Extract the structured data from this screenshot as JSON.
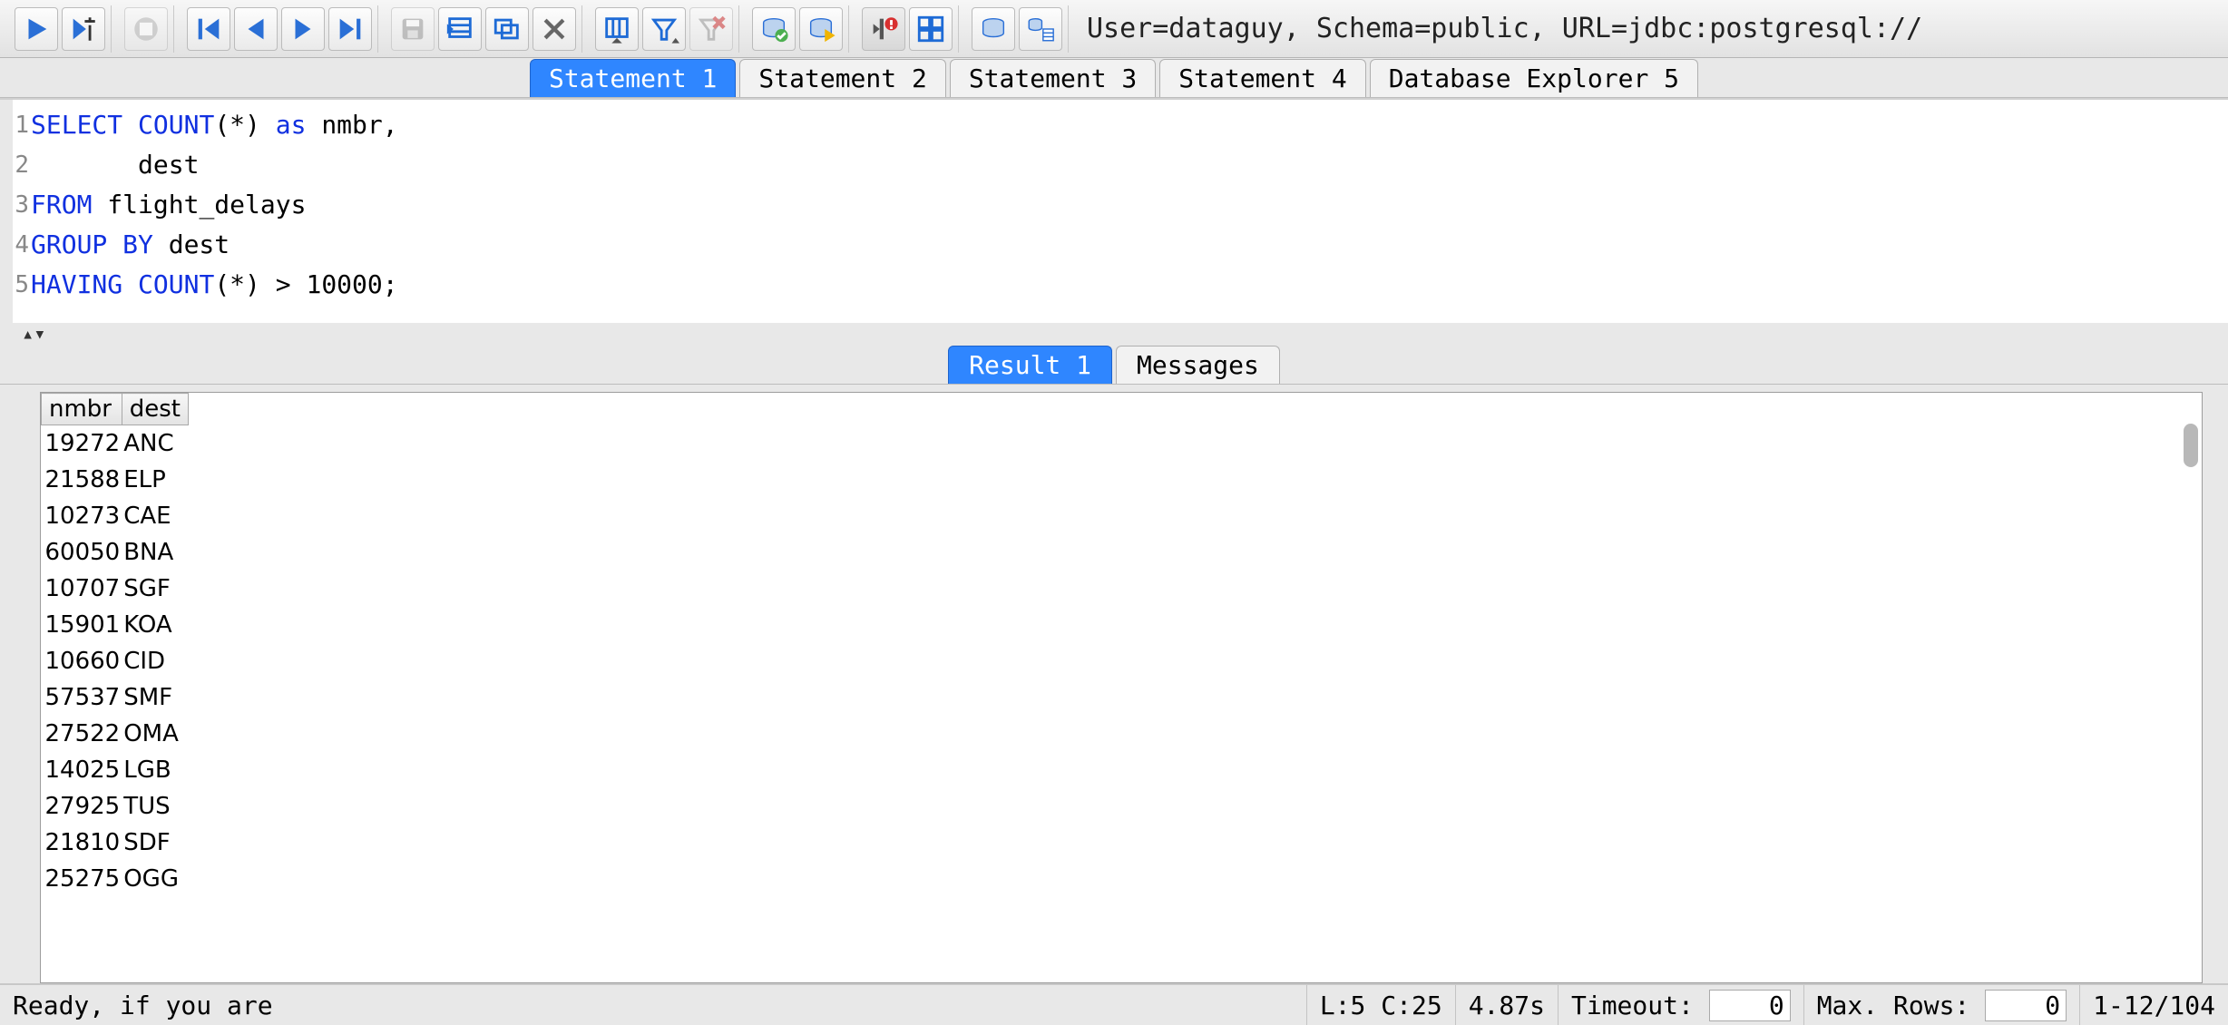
{
  "connection_info": "User=dataguy, Schema=public, URL=jdbc:postgresql://",
  "statement_tabs": [
    {
      "label": "Statement 1",
      "active": true
    },
    {
      "label": "Statement 2",
      "active": false
    },
    {
      "label": "Statement 3",
      "active": false
    },
    {
      "label": "Statement 4",
      "active": false
    },
    {
      "label": "Database Explorer 5",
      "active": false
    }
  ],
  "sql": {
    "lines": [
      {
        "n": "1",
        "tokens": [
          {
            "t": "SELECT",
            "c": "kw"
          },
          {
            "t": " ",
            "c": ""
          },
          {
            "t": "COUNT",
            "c": "fn"
          },
          {
            "t": "(*) ",
            "c": "ident"
          },
          {
            "t": "as",
            "c": "kw"
          },
          {
            "t": " nmbr,",
            "c": "ident"
          }
        ]
      },
      {
        "n": "2",
        "tokens": [
          {
            "t": "       dest",
            "c": "ident"
          }
        ]
      },
      {
        "n": "3",
        "tokens": [
          {
            "t": "FROM",
            "c": "kw"
          },
          {
            "t": " flight_delays",
            "c": "ident"
          }
        ]
      },
      {
        "n": "4",
        "tokens": [
          {
            "t": "GROUP BY",
            "c": "kw"
          },
          {
            "t": " dest",
            "c": "ident"
          }
        ]
      },
      {
        "n": "5",
        "tokens": [
          {
            "t": "HAVING",
            "c": "kw"
          },
          {
            "t": " ",
            "c": ""
          },
          {
            "t": "COUNT",
            "c": "fn"
          },
          {
            "t": "(*) > 10000;",
            "c": "ident"
          }
        ]
      }
    ]
  },
  "result_tabs": [
    {
      "label": "Result 1",
      "active": true
    },
    {
      "label": "Messages",
      "active": false
    }
  ],
  "result": {
    "columns": [
      "nmbr",
      "dest"
    ],
    "rows": [
      {
        "nmbr": "19272",
        "dest": "ANC"
      },
      {
        "nmbr": "21588",
        "dest": "ELP"
      },
      {
        "nmbr": "10273",
        "dest": "CAE"
      },
      {
        "nmbr": "60050",
        "dest": "BNA"
      },
      {
        "nmbr": "10707",
        "dest": "SGF"
      },
      {
        "nmbr": "15901",
        "dest": "KOA"
      },
      {
        "nmbr": "10660",
        "dest": "CID"
      },
      {
        "nmbr": "57537",
        "dest": "SMF"
      },
      {
        "nmbr": "27522",
        "dest": "OMA"
      },
      {
        "nmbr": "14025",
        "dest": "LGB"
      },
      {
        "nmbr": "27925",
        "dest": "TUS"
      },
      {
        "nmbr": "21810",
        "dest": "SDF"
      },
      {
        "nmbr": "25275",
        "dest": "OGG"
      }
    ]
  },
  "status": {
    "message": "Ready, if you are",
    "cursor": "L:5 C:25",
    "elapsed": "4.87s",
    "timeout_label": "Timeout:",
    "timeout_value": "0",
    "maxrows_label": "Max. Rows:",
    "maxrows_value": "0",
    "rowrange": "1-12/104"
  }
}
